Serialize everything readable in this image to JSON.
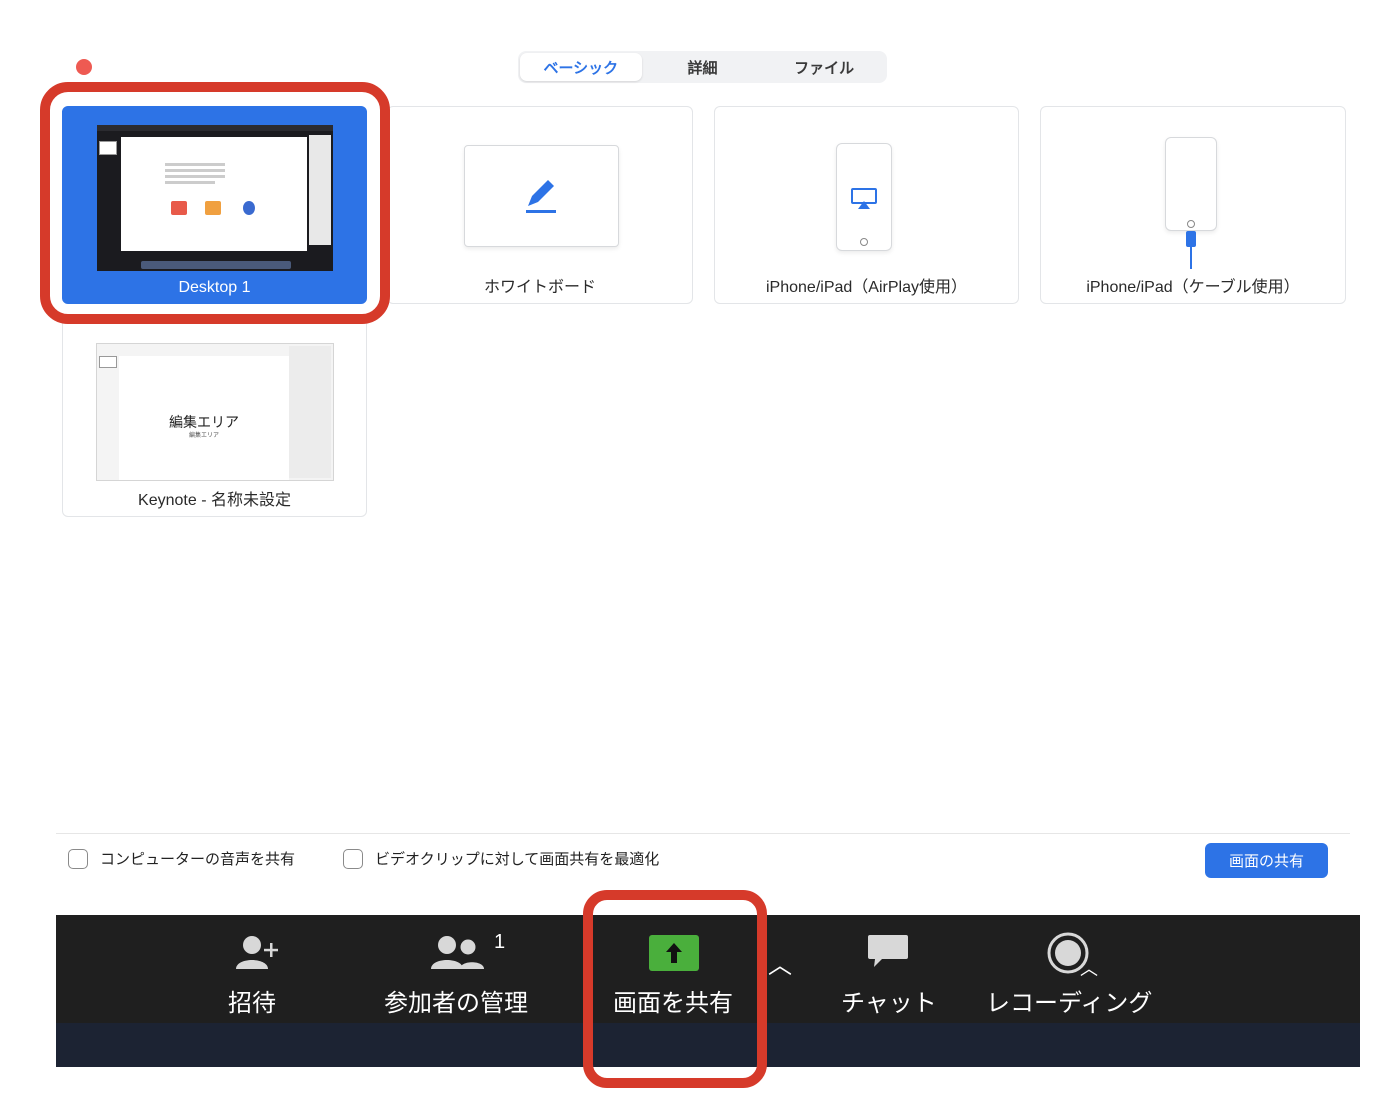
{
  "tabs": [
    {
      "label": "ベーシック",
      "active": true
    },
    {
      "label": "詳細",
      "active": false
    },
    {
      "label": "ファイル",
      "active": false
    }
  ],
  "sources": [
    {
      "label": "Desktop 1",
      "selected": true,
      "icon": "desktop-thumbnail"
    },
    {
      "label": "ホワイトボード",
      "selected": false,
      "icon": "pen-icon"
    },
    {
      "label": "iPhone/iPad（AirPlay使用）",
      "selected": false,
      "icon": "airplay-icon"
    },
    {
      "label": "iPhone/iPad（ケーブル使用）",
      "selected": false,
      "icon": "cable-icon"
    },
    {
      "label": "Keynote - 名称未設定",
      "selected": false,
      "icon": "keynote-thumbnail"
    }
  ],
  "keynote_preview": {
    "title": "編集エリア",
    "subtitle": "編集エリア"
  },
  "options": {
    "share_audio": {
      "label": "コンピューターの音声を共有",
      "checked": false
    },
    "optimize_video": {
      "label": "ビデオクリップに対して画面共有を最適化",
      "checked": false
    }
  },
  "share_button": "画面の共有",
  "toolbar": {
    "invite": "招待",
    "participants": "参加者の管理",
    "participants_count": "1",
    "share_screen": "画面を共有",
    "chat": "チャット",
    "recording": "レコーディング"
  },
  "colors": {
    "accent": "#2d73e6",
    "highlight": "#d63a2a",
    "share_green": "#4aaf3c"
  }
}
